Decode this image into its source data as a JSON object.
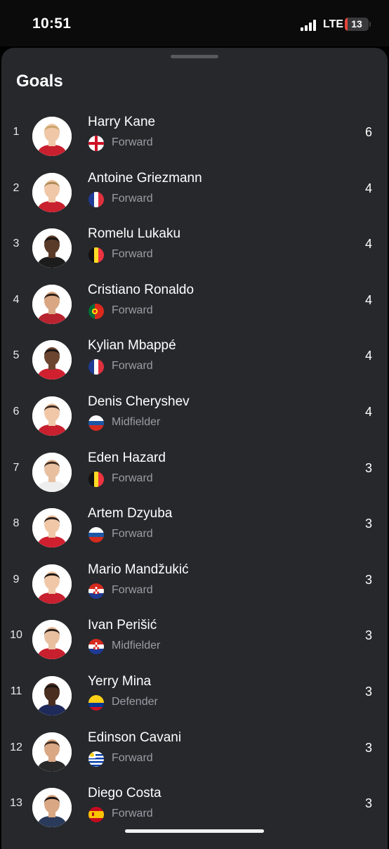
{
  "status_bar": {
    "time": "10:51",
    "network": "LTE",
    "battery": "13",
    "battery_level": 0.13
  },
  "sheet": {
    "title": "Goals"
  },
  "players": [
    {
      "rank": "1",
      "name": "Harry Kane",
      "position": "Forward",
      "goals": "6",
      "flag": "england",
      "hair": "#c9a46a",
      "skin": "#f0c8a8",
      "shirt": "#c8202e"
    },
    {
      "rank": "2",
      "name": "Antoine Griezmann",
      "position": "Forward",
      "goals": "4",
      "flag": "france",
      "hair": "#b08a55",
      "skin": "#f0c8a8",
      "shirt": "#c8202e"
    },
    {
      "rank": "3",
      "name": "Romelu Lukaku",
      "position": "Forward",
      "goals": "4",
      "flag": "belgium",
      "hair": "#1a1412",
      "skin": "#5a3a28",
      "shirt": "#1c1c1c"
    },
    {
      "rank": "4",
      "name": "Cristiano Ronaldo",
      "position": "Forward",
      "goals": "4",
      "flag": "portugal",
      "hair": "#2a1e18",
      "skin": "#d9a783",
      "shirt": "#b8232f"
    },
    {
      "rank": "5",
      "name": "Kylian Mbappé",
      "position": "Forward",
      "goals": "4",
      "flag": "france",
      "hair": "#1a1412",
      "skin": "#6b4530",
      "shirt": "#d02030"
    },
    {
      "rank": "6",
      "name": "Denis Cheryshev",
      "position": "Midfielder",
      "goals": "4",
      "flag": "russia",
      "hair": "#3a2a20",
      "skin": "#f0c8a8",
      "shirt": "#c8202e"
    },
    {
      "rank": "7",
      "name": "Eden Hazard",
      "position": "Forward",
      "goals": "3",
      "flag": "belgium",
      "hair": "#3a2a20",
      "skin": "#e8c0a0",
      "shirt": "#eeeeee"
    },
    {
      "rank": "8",
      "name": "Artem Dzyuba",
      "position": "Forward",
      "goals": "3",
      "flag": "russia",
      "hair": "#2a1e18",
      "skin": "#f0c8a8",
      "shirt": "#d02030"
    },
    {
      "rank": "9",
      "name": "Mario Mandžukić",
      "position": "Forward",
      "goals": "3",
      "flag": "croatia",
      "hair": "#1a1412",
      "skin": "#f0c8a8",
      "shirt": "#c8202e"
    },
    {
      "rank": "10",
      "name": "Ivan Perišić",
      "position": "Midfielder",
      "goals": "3",
      "flag": "croatia",
      "hair": "#2a1e18",
      "skin": "#e8c0a0",
      "shirt": "#c8202e"
    },
    {
      "rank": "11",
      "name": "Yerry Mina",
      "position": "Defender",
      "goals": "3",
      "flag": "colombia",
      "hair": "#1a1412",
      "skin": "#4a2e20",
      "shirt": "#1e2a5a"
    },
    {
      "rank": "12",
      "name": "Edinson Cavani",
      "position": "Forward",
      "goals": "3",
      "flag": "uruguay",
      "hair": "#3a2a20",
      "skin": "#d9a783",
      "shirt": "#2a2a2a"
    },
    {
      "rank": "13",
      "name": "Diego Costa",
      "position": "Forward",
      "goals": "3",
      "flag": "spain",
      "hair": "#1a1412",
      "skin": "#d9a783",
      "shirt": "#2a3a5a"
    }
  ],
  "colors": {
    "background": "#000000",
    "sheet": "#26282c",
    "secondary_text": "#9a9ea4",
    "battery_low": "#e5453b"
  }
}
